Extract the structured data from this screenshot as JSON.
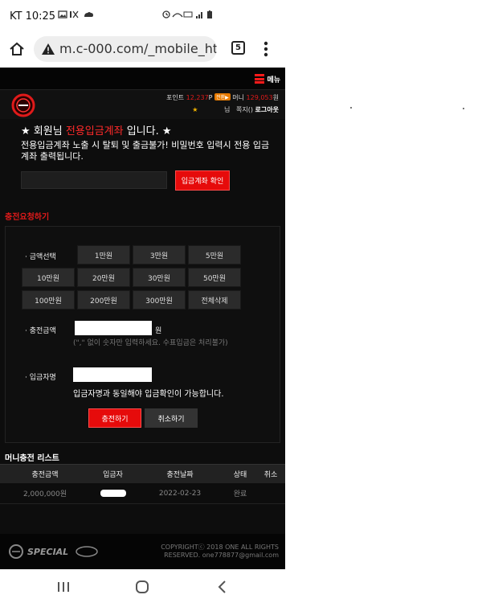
{
  "status_bar": {
    "time": "KT 10:25"
  },
  "browser": {
    "url": "m.c-000.com/_mobile_html/i",
    "tab_count": "5"
  },
  "topbar": {
    "menu_label": "메뉴"
  },
  "header": {
    "point_label": "포인트",
    "point_value": "12,237",
    "point_unit": "P",
    "convert_badge": "전환▶",
    "money_label": "머니",
    "money_value": "129,053",
    "money_unit": "원",
    "user_suffix": "님",
    "messages": "쪽지()",
    "logout": "로그아웃"
  },
  "notice": {
    "title_prefix": "★ 회원님",
    "title_highlight": "전용입금계좌",
    "title_suffix": "입니다. ★",
    "description": "전용입금계좌 노출 시 탈퇴 및 출금불가! 비밀번호 입력시 전용 입금계좌 출력됩니다.",
    "check_button": "입금계좌 확인"
  },
  "charge": {
    "section_title": "충전요청하기",
    "amount_select_label": "· 금액선택",
    "amount_buttons": [
      "1만원",
      "3만원",
      "5만원",
      "10만원",
      "20만원",
      "30만원",
      "50만원",
      "100만원",
      "200만원",
      "300만원",
      "전체삭제"
    ],
    "amount_label": "· 충전금액",
    "amount_unit": "원",
    "amount_hint": "(\",\" 없이 숫자만 입력하세요. 수표입금은 처리불가)",
    "depositor_label": "· 입금자명",
    "depositor_note": "입금자명과 동일해야 입금확인이 가능합니다.",
    "submit_button": "충전하기",
    "cancel_button": "취소하기"
  },
  "money_list": {
    "title": "머니충전 리스트",
    "columns": [
      "충전금액",
      "입금자",
      "충전날짜",
      "상태",
      "취소"
    ],
    "rows": [
      {
        "amount": "2,000,000원",
        "depositor": "",
        "date": "2022-02-23",
        "status": "완료",
        "cancel": ""
      }
    ]
  },
  "footer": {
    "logo_text": "SPECIAL",
    "copyright_line1": "COPYRIGHTⓒ 2018 ONE ALL RIGHTS",
    "copyright_line2": "RESERVED. one778877@gmail.com"
  },
  "colors": {
    "accent": "#e60b0b",
    "background": "#0d0d0d",
    "badge": "#e77a00"
  }
}
